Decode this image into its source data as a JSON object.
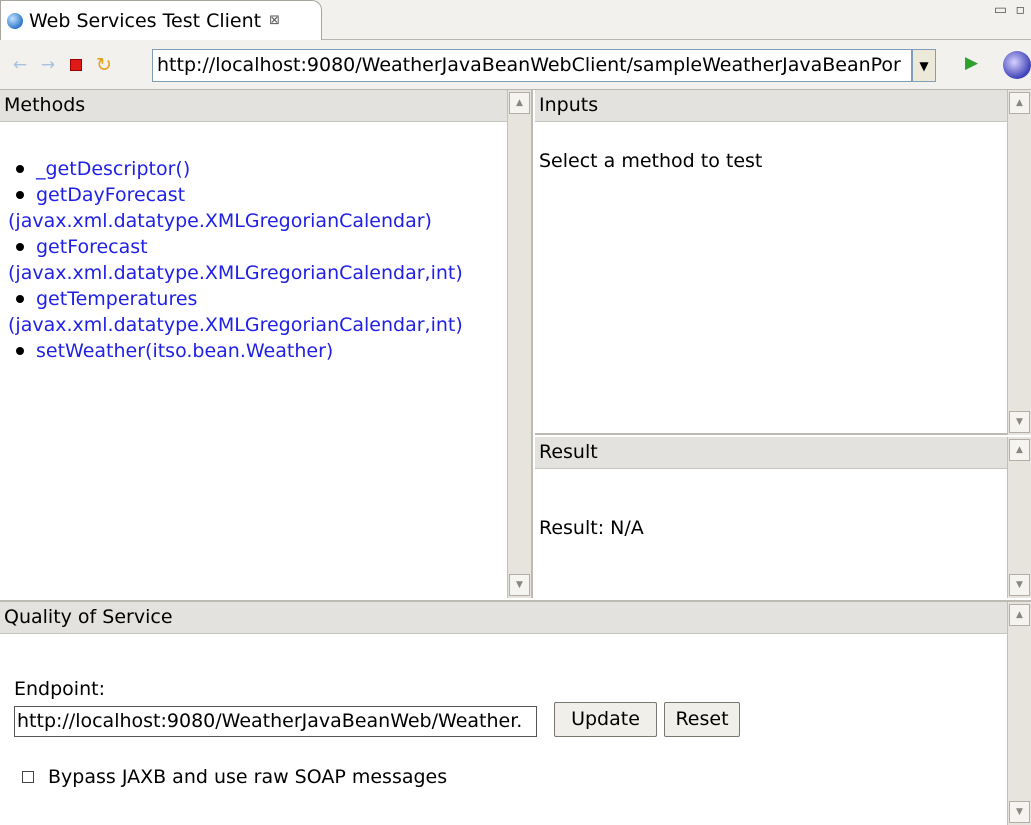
{
  "tab": {
    "title": "Web Services Test Client",
    "close_glyph": "⊠"
  },
  "window_controls": "▭ ▫",
  "toolbar": {
    "back_icon": "←",
    "forward_icon": "→",
    "refresh_icon": "↻",
    "url": "http://localhost:9080/WeatherJavaBeanWebClient/sampleWeatherJavaBeanPor",
    "go_icon": "▶"
  },
  "methods": {
    "header": "Methods",
    "items": [
      {
        "line1": "_getDescriptor()",
        "line2": ""
      },
      {
        "line1": "getDayForecast",
        "line2": "(javax.xml.datatype.XMLGregorianCalendar)"
      },
      {
        "line1": "getForecast",
        "line2": "(javax.xml.datatype.XMLGregorianCalendar,int)"
      },
      {
        "line1": "getTemperatures",
        "line2": "(javax.xml.datatype.XMLGregorianCalendar,int)"
      },
      {
        "line1": "setWeather(itso.bean.Weather)",
        "line2": ""
      }
    ]
  },
  "inputs": {
    "header": "Inputs",
    "message": "Select a method to test"
  },
  "result": {
    "header": "Result",
    "message": "Result: N/A"
  },
  "qos": {
    "header": "Quality of Service",
    "endpoint_label": "Endpoint:",
    "endpoint_value": "http://localhost:9080/WeatherJavaBeanWeb/Weather.",
    "update_label": "Update",
    "reset_label": "Reset",
    "bypass_label": "Bypass JAXB and use raw SOAP messages",
    "bypass_checked": false
  },
  "colors": {
    "link": "#1f1fe6",
    "header_bg": "#e4e2de",
    "toolbar_bg": "#f3f1ee"
  }
}
